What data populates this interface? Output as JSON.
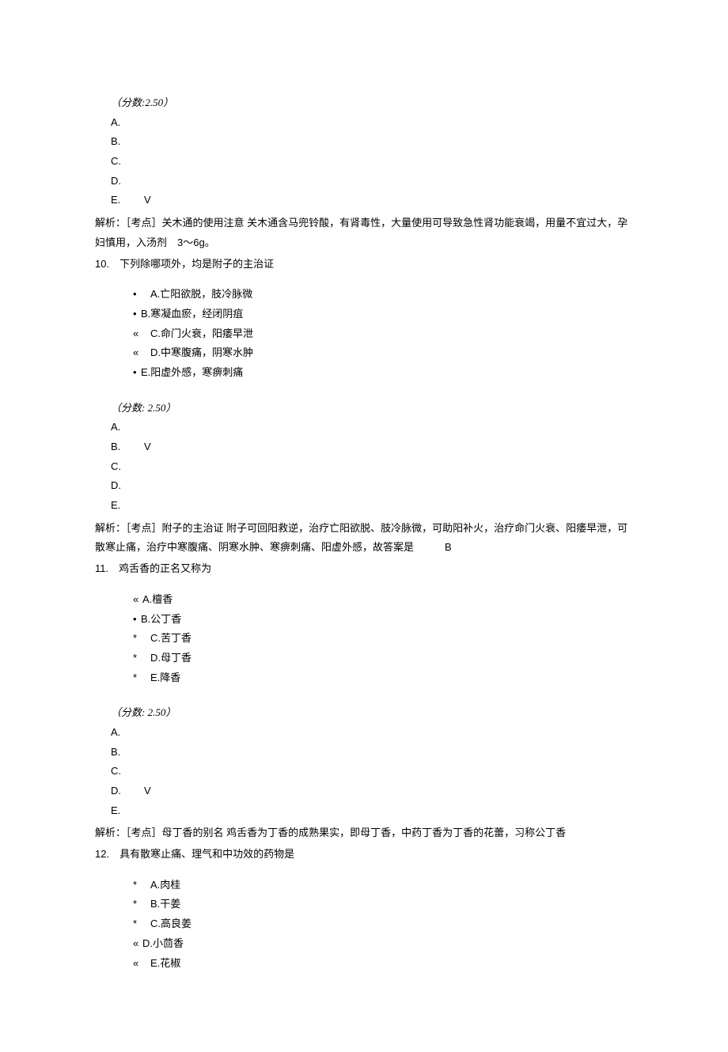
{
  "q9": {
    "score_label": "（分数:2.50）",
    "answers": {
      "A": "A.",
      "B": "B.",
      "C": "C.",
      "D": "D.",
      "E": "E.",
      "check": "V"
    },
    "jiexi": "解析：［考点］关木通的使用注意 关木通含马兜铃酸，有肾毒性，大量使用可导致急性肾功能衰竭，用量不宜过大，孕妇慎用，入汤剂　3～6g。"
  },
  "q10": {
    "header": "10.　下列除哪项外，均是附子的主治证",
    "opts": {
      "A": {
        "b": "•",
        "t": "A.亡阳欲脱，肢冷脉微"
      },
      "B": {
        "b": "•",
        "t": "B.寒凝血瘀，经闭阴疽"
      },
      "C": {
        "b": "«",
        "t": "C.命门火衰，阳痿早泄"
      },
      "D": {
        "b": "«",
        "t": "D.中寒腹痛，阴寒水肿"
      },
      "E": {
        "b": "•",
        "t": "E.阳虚外感，寒痹刺痛"
      }
    },
    "score_label": "（分数: 2.50）",
    "answers": {
      "A": "A.",
      "B": "B.",
      "C": "C.",
      "D": "D.",
      "E": "E.",
      "check": "V"
    },
    "jiexi": "解析：［考点］附子的主治证 附子可回阳救逆，治疗亡阳欲脱、肢冷脉微，可助阳补火，治疗命门火衰、阳痿早泄，可散寒止痛，治疗中寒腹痛、阴寒水肿、寒痹刺痛、阳虚外感，故答案是　　　B"
  },
  "q11": {
    "header": "11.　鸡舌香的正名又称为",
    "opts": {
      "A": {
        "b": "«",
        "t": "A.檀香"
      },
      "B": {
        "b": "•",
        "t": "B.公丁香"
      },
      "C": {
        "b": "*",
        "t": "C.苦丁香"
      },
      "D": {
        "b": "*",
        "t": "D.母丁香"
      },
      "E": {
        "b": "*",
        "t": "E.降香"
      }
    },
    "score_label": "（分数: 2.50）",
    "answers": {
      "A": "A.",
      "B": "B.",
      "C": "C.",
      "D": "D.",
      "E": "E.",
      "check": "V"
    },
    "jiexi": "解析：［考点］母丁香的别名 鸡舌香为丁香的成熟果实，即母丁香，中药丁香为丁香的花蕾，习称公丁香"
  },
  "q12": {
    "header": "12.　具有散寒止痛、理气和中功效的药物是",
    "opts": {
      "A": {
        "b": "*",
        "t": "A.肉桂"
      },
      "B": {
        "b": "*",
        "t": "B.干姜"
      },
      "C": {
        "b": "*",
        "t": "C.高良姜"
      },
      "D": {
        "b": "«",
        "t": "D.小茴香"
      },
      "E": {
        "b": "«",
        "t": "E.花椒"
      }
    }
  }
}
